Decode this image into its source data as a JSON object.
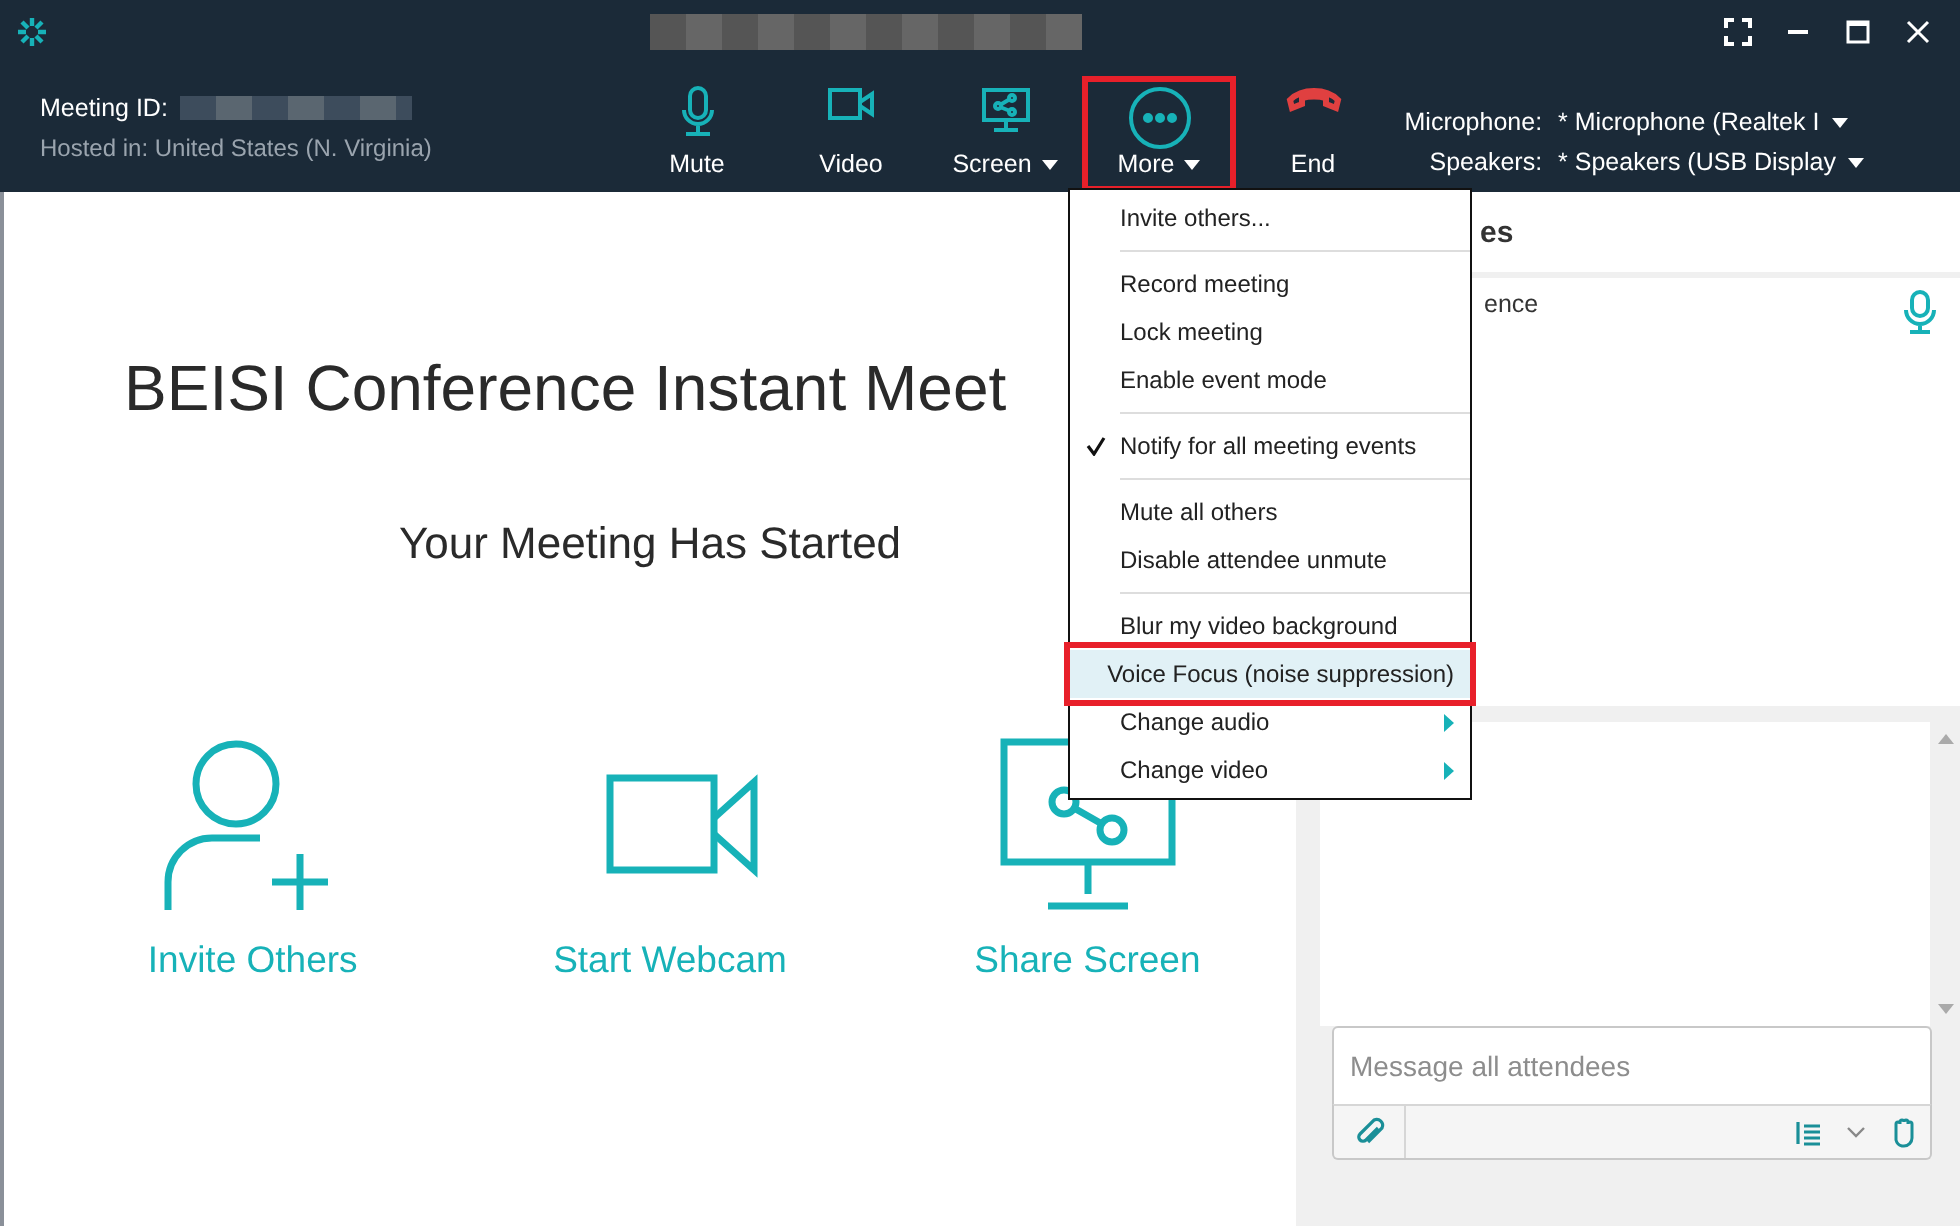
{
  "meeting": {
    "id_label": "Meeting ID:",
    "hosted": "Hosted in: United States (N. Virginia)"
  },
  "toolbar": [
    {
      "label": "Mute",
      "kind": "mic",
      "dropdown": false,
      "annotated": false
    },
    {
      "label": "Video",
      "kind": "video",
      "dropdown": false,
      "annotated": false
    },
    {
      "label": "Screen",
      "kind": "screen",
      "dropdown": true,
      "annotated": false
    },
    {
      "label": "More",
      "kind": "more",
      "dropdown": true,
      "annotated": true
    },
    {
      "label": "End",
      "kind": "end",
      "dropdown": false,
      "annotated": false
    }
  ],
  "devices": [
    {
      "label": "Microphone:",
      "value": "* Microphone (Realtek I"
    },
    {
      "label": "Speakers:",
      "value": "* Speakers (USB Display"
    }
  ],
  "main": {
    "title": "BEISI Conference Instant Meet",
    "subtitle": "Your Meeting Has Started",
    "actions": [
      {
        "label": "Invite Others",
        "kind": "invite"
      },
      {
        "label": "Start Webcam",
        "kind": "webcam"
      },
      {
        "label": "Share Screen",
        "kind": "share"
      }
    ]
  },
  "attendees": {
    "header": "es",
    "rows": [
      {
        "name": "ence",
        "muted": false
      }
    ]
  },
  "chat": {
    "placeholder": "Message all attendees"
  },
  "menu": {
    "groups": [
      [
        {
          "label": "Invite others...",
          "checked": false,
          "selected": false,
          "submenu": false,
          "annotated": false
        }
      ],
      [
        {
          "label": "Record meeting",
          "checked": false,
          "selected": false,
          "submenu": false,
          "annotated": false
        },
        {
          "label": "Lock meeting",
          "checked": false,
          "selected": false,
          "submenu": false,
          "annotated": false
        },
        {
          "label": "Enable event mode",
          "checked": false,
          "selected": false,
          "submenu": false,
          "annotated": false
        }
      ],
      [
        {
          "label": "Notify for all meeting events",
          "checked": true,
          "selected": false,
          "submenu": false,
          "annotated": false
        }
      ],
      [
        {
          "label": "Mute all others",
          "checked": false,
          "selected": false,
          "submenu": false,
          "annotated": false
        },
        {
          "label": "Disable attendee unmute",
          "checked": false,
          "selected": false,
          "submenu": false,
          "annotated": false
        }
      ],
      [
        {
          "label": "Blur my video background",
          "checked": false,
          "selected": false,
          "submenu": false,
          "annotated": false
        },
        {
          "label": "Voice Focus (noise suppression)",
          "checked": false,
          "selected": true,
          "submenu": false,
          "annotated": true
        },
        {
          "label": "Change audio",
          "checked": false,
          "selected": false,
          "submenu": true,
          "annotated": false
        },
        {
          "label": "Change video",
          "checked": false,
          "selected": false,
          "submenu": true,
          "annotated": false
        }
      ]
    ]
  }
}
